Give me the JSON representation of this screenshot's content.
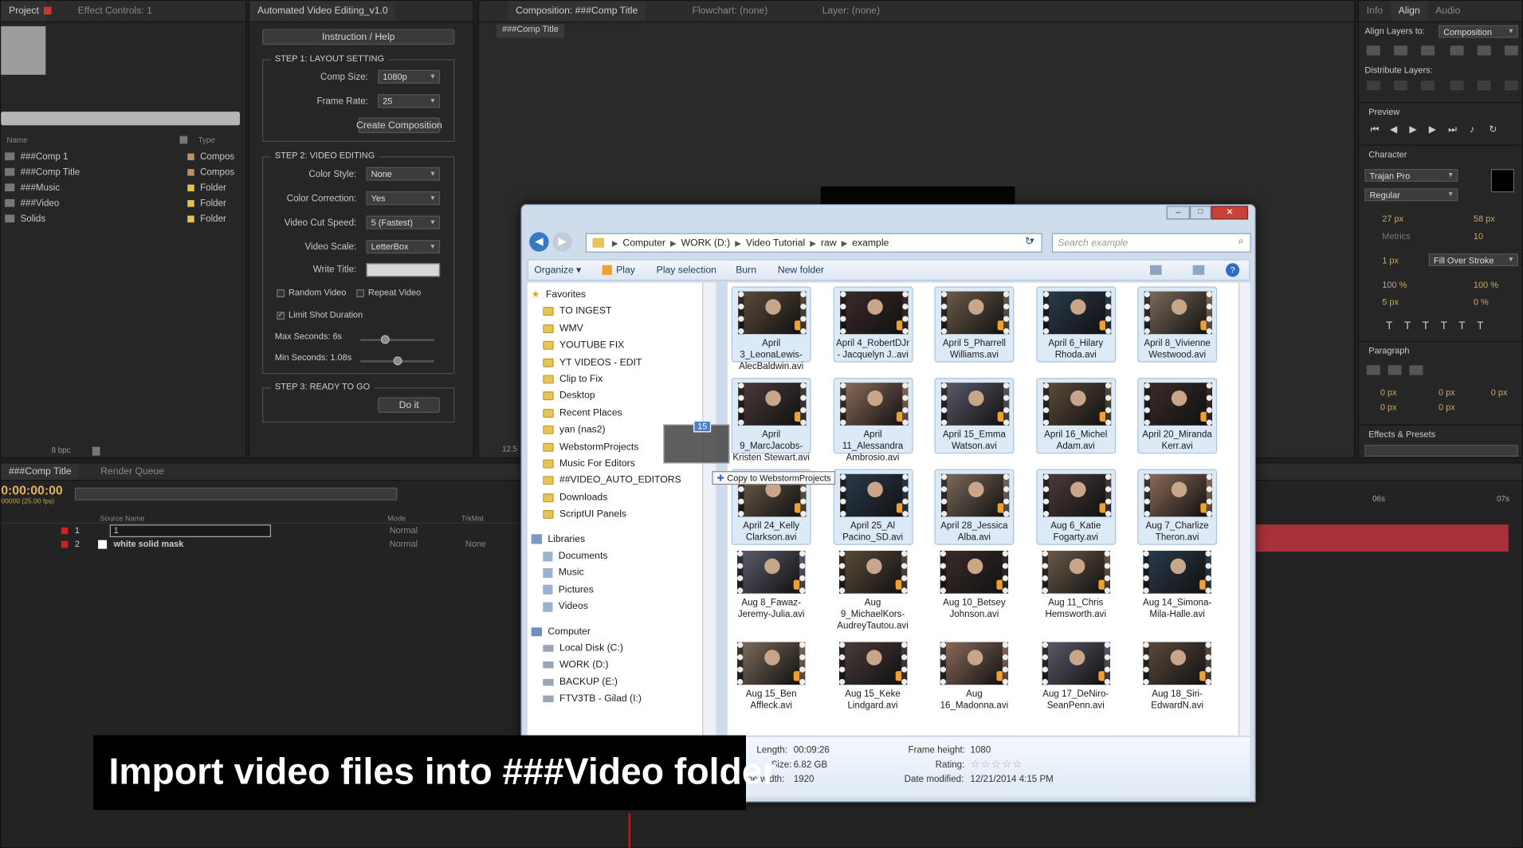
{
  "project_panel": {
    "tabs": [
      "Project",
      "Effect Controls: 1"
    ],
    "columns": {
      "name": "Name",
      "type": "Type"
    },
    "items": [
      {
        "name": "###Comp 1",
        "type": "Compos",
        "color": "#b8906a"
      },
      {
        "name": "###Comp Title",
        "type": "Compos",
        "color": "#b8906a"
      },
      {
        "name": "###Music",
        "type": "Folder",
        "color": "#e4c34a"
      },
      {
        "name": "###Video",
        "type": "Folder",
        "color": "#e4c34a"
      },
      {
        "name": "Solids",
        "type": "Folder",
        "color": "#e4c34a"
      }
    ],
    "bpc": "8 bpc"
  },
  "script_panel": {
    "tab": "Automated Video Editing_v1.0",
    "help_button": "Instruction / Help",
    "step1": {
      "title": "STEP 1: LAYOUT SETTING",
      "comp_size_label": "Comp Size:",
      "comp_size_value": "1080p",
      "frame_rate_label": "Frame Rate:",
      "frame_rate_value": "25",
      "create_button": "Create Composition"
    },
    "step2": {
      "title": "STEP 2: VIDEO EDITING",
      "color_style_label": "Color Style:",
      "color_style_value": "None",
      "color_correction_label": "Color Correction:",
      "color_correction_value": "Yes",
      "cut_speed_label": "Video Cut Speed:",
      "cut_speed_value": "5 (Fastest)",
      "video_scale_label": "Video Scale:",
      "video_scale_value": "LetterBox",
      "write_title_label": "Write Title:",
      "random_video": "Random Video",
      "repeat_video": "Repeat Video",
      "limit_shot": "Limit Shot Duration",
      "max_seconds": "Max Seconds: 6s",
      "min_seconds": "Min Seconds: 1.08s",
      "max_slider_value": 0.33,
      "min_slider_value": 0.5
    },
    "step3": {
      "title": "STEP 3: READY TO GO",
      "do_button": "Do it"
    }
  },
  "composition_panel": {
    "tabs": [
      "Composition: ###Comp Title",
      "Flowchart: (none)",
      "Layer: (none)"
    ],
    "subtab": "###Comp Title",
    "zoom": "12.5"
  },
  "right_panels": {
    "tabs": [
      "Info",
      "Align",
      "Audio"
    ],
    "align_to_label": "Align Layers to:",
    "align_to_value": "Composition",
    "distribute_label": "Distribute Layers:",
    "preview_tab": "Preview",
    "character_tab": "Character",
    "font": "Trajan Pro",
    "style": "Regular",
    "size": "27 px",
    "leading": "58 px",
    "kerning": "Metrics",
    "tracking": "10",
    "stroke": "1 px",
    "stroke_mode": "Fill Over Stroke",
    "vscale": "100 %",
    "hscale": "100 %",
    "baseline": "5 px",
    "tsume": "0 %",
    "paragraph_tab": "Paragraph",
    "para_values": [
      "0 px",
      "0 px",
      "0 px",
      "0 px",
      "0 px"
    ],
    "effects_tab": "Effects & Presets"
  },
  "timeline": {
    "tabs": [
      "###Comp Title",
      "Render Queue"
    ],
    "timecode": "0:00:00:00",
    "fps": "00000 (25.00 fps)",
    "columns": {
      "source": "Source Name",
      "mode": "Mode",
      "trkmat": "TrkMat"
    },
    "layers": [
      {
        "num": "1",
        "name": "1",
        "mode": "Normal",
        "trkmat": ""
      },
      {
        "num": "2",
        "name": "white solid mask",
        "mode": "Normal",
        "trkmat": "None"
      }
    ],
    "ruler": [
      "06s",
      "07s"
    ]
  },
  "explorer": {
    "breadcrumb": [
      "Computer",
      "WORK (D:)",
      "Video Tutorial",
      "raw",
      "example"
    ],
    "search_placeholder": "Search example",
    "commands": [
      "Organize",
      "Play",
      "Play selection",
      "Burn",
      "New folder"
    ],
    "nav": {
      "favorites_label": "Favorites",
      "favorites": [
        "TO INGEST",
        "WMV",
        "YOUTUBE FIX",
        "YT VIDEOS  - EDIT",
        "Clip to Fix",
        "Desktop",
        "Recent Places",
        "yan (nas2)",
        "WebstormProjects",
        "Music For Editors",
        "##VIDEO_AUTO_EDITORS",
        "Downloads",
        "ScriptUI Panels"
      ],
      "libraries_label": "Libraries",
      "libraries": [
        "Documents",
        "Music",
        "Pictures",
        "Videos"
      ],
      "computer_label": "Computer",
      "drives": [
        "Local Disk (C:)",
        "WORK (D:)",
        "BACKUP (E:)",
        "FTV3TB - Gilad (I:)"
      ]
    },
    "drag_count": "15",
    "drag_tooltip": "Copy to WebstormProjects",
    "files": [
      "April 3_LeonaLewis-AlecBaldwin.avi",
      "April 4_RobertDJr - Jacquelyn J..avi",
      "April 5_Pharrell Williams.avi",
      "April 6_Hilary Rhoda.avi",
      "April 8_Vivienne Westwood.avi",
      "April 9_MarcJacobs-Kristen Stewart.avi",
      "April 11_Alessandra Ambrosio.avi",
      "April 15_Emma Watson.avi",
      "April 16_Michel Adam.avi",
      "April 20_Miranda Kerr.avi",
      "April 24_Kelly Clarkson.avi",
      "April 25_Al Pacino_SD.avi",
      "April 28_Jessica Alba.avi",
      "Aug 6_Katie Fogarty.avi",
      "Aug 7_Charlize Theron.avi",
      "Aug 8_Fawaz-Jeremy-Julia.avi",
      "Aug 9_MichaelKors-AudreyTautou.avi",
      "Aug 10_Betsey Johnson.avi",
      "Aug 11_Chris Hemsworth.avi",
      "Aug 14_Simona-Mila-Halle.avi",
      "Aug 15_Ben Affleck.avi",
      "Aug 15_Keke Lindgard.avi",
      "Aug 16_Madonna.avi",
      "Aug 17_DeNiro-SeanPenn.avi",
      "Aug 18_Siri-EdwardN.avi"
    ],
    "details": {
      "length_label": "Length:",
      "length": "00:09:26",
      "size_label": "Size:",
      "size": "6.82 GB",
      "width_label": "me width:",
      "width": "1920",
      "height_label": "Frame height:",
      "height": "1080",
      "rating_label": "Rating:",
      "modified_label": "Date modified:",
      "modified": "12/21/2014 4:15 PM"
    }
  },
  "caption": "Import video files into ###Video folder"
}
